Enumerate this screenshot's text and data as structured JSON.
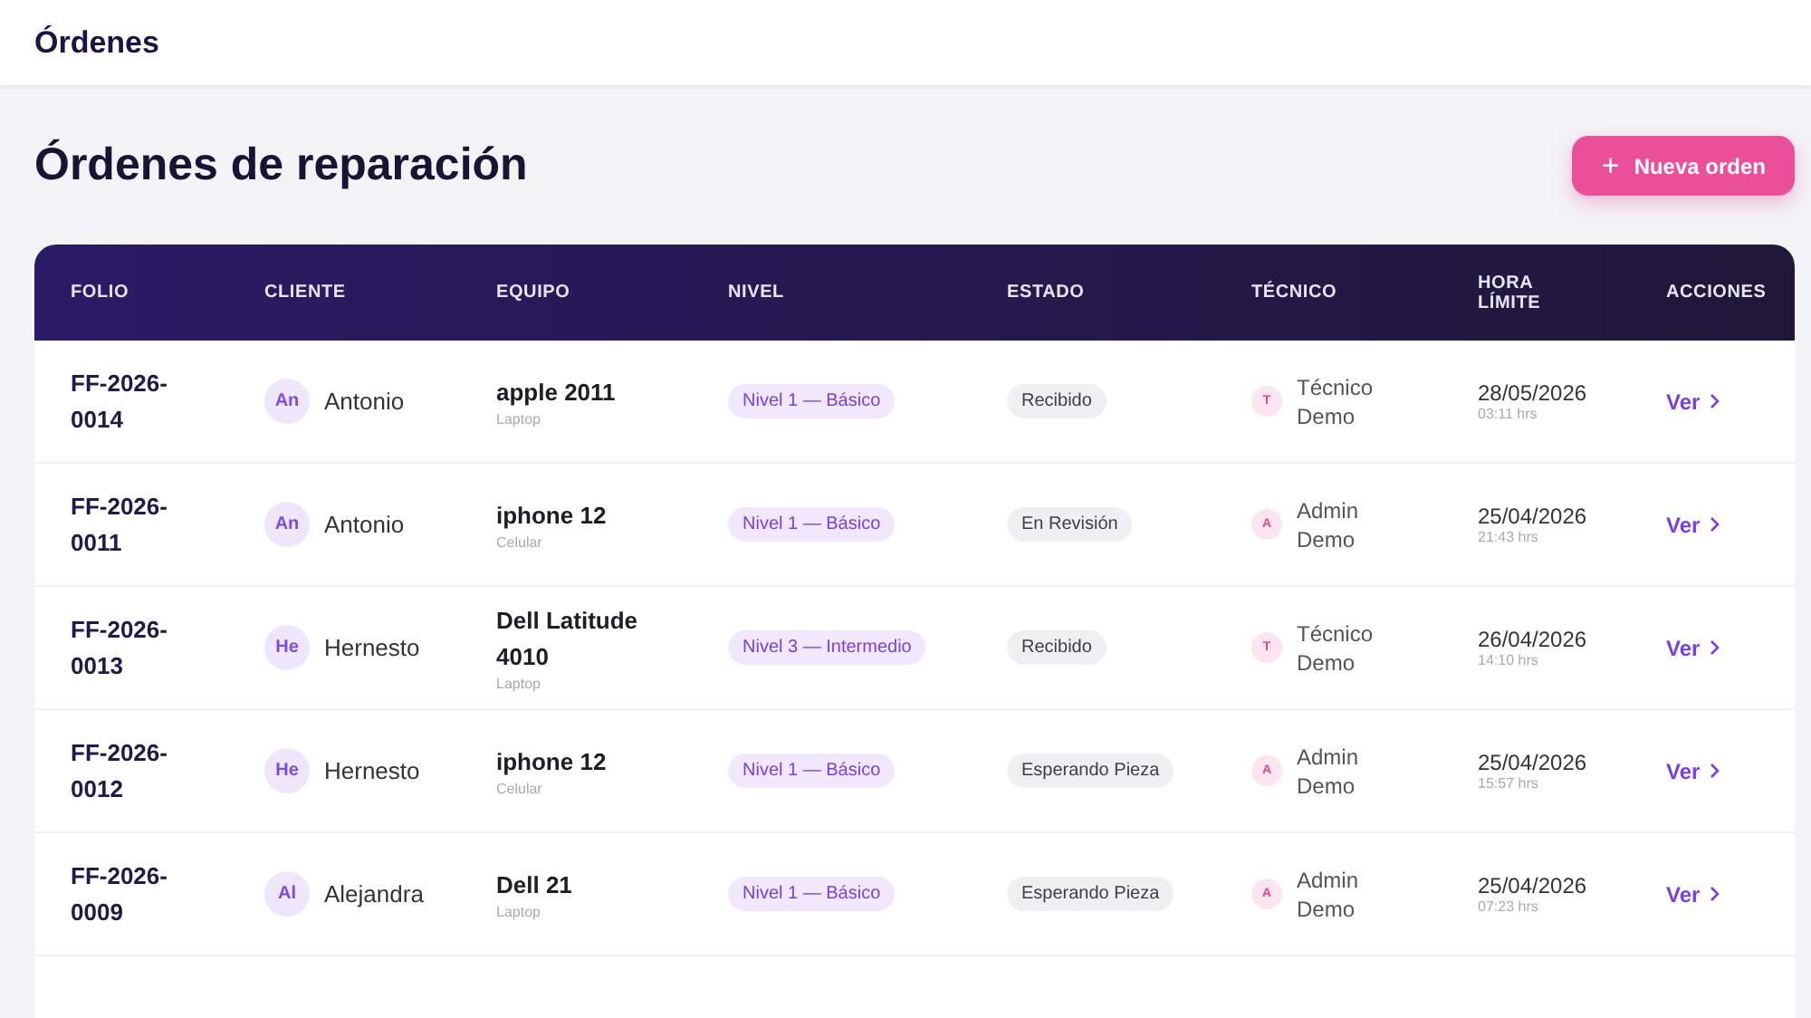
{
  "topbar": {
    "title": "Órdenes"
  },
  "page": {
    "title": "Órdenes de reparación",
    "new_button": {
      "icon": "+",
      "label": "Nueva orden"
    }
  },
  "table": {
    "columns": [
      "FOLIO",
      "CLIENTE",
      "EQUIPO",
      "NIVEL",
      "ESTADO",
      "TÉCNICO",
      "HORA LÍMITE",
      "ACCIONES"
    ],
    "rows": [
      {
        "folio": "FF-2026-0014",
        "client_initials": "An",
        "client": "Antonio",
        "device": "apple 2011",
        "device_type": "Laptop",
        "level": "Nivel 1 — Básico",
        "status": "Recibido",
        "tech_initial": "T",
        "tech": "Técnico Demo",
        "date": "28/05/2026",
        "time": "03:11 hrs",
        "action": "Ver"
      },
      {
        "folio": "FF-2026-0011",
        "client_initials": "An",
        "client": "Antonio",
        "device": "iphone 12",
        "device_type": "Celular",
        "level": "Nivel 1 — Básico",
        "status": "En Revisión",
        "tech_initial": "A",
        "tech": "Admin Demo",
        "date": "25/04/2026",
        "time": "21:43 hrs",
        "action": "Ver"
      },
      {
        "folio": "FF-2026-0013",
        "client_initials": "He",
        "client": "Hernesto",
        "device": "Dell Latitude 4010",
        "device_type": "Laptop",
        "level": "Nivel 3 — Intermedio",
        "status": "Recibido",
        "tech_initial": "T",
        "tech": "Técnico Demo",
        "date": "26/04/2026",
        "time": "14:10 hrs",
        "action": "Ver"
      },
      {
        "folio": "FF-2026-0012",
        "client_initials": "He",
        "client": "Hernesto",
        "device": "iphone 12",
        "device_type": "Celular",
        "level": "Nivel 1 — Básico",
        "status": "Esperando Pieza",
        "tech_initial": "A",
        "tech": "Admin Demo",
        "date": "25/04/2026",
        "time": "15:57 hrs",
        "action": "Ver"
      },
      {
        "folio": "FF-2026-0009",
        "client_initials": "Al",
        "client": "Alejandra",
        "device": "Dell 21",
        "device_type": "Laptop",
        "level": "Nivel 1 — Básico",
        "status": "Esperando Pieza",
        "tech_initial": "A",
        "tech": "Admin Demo",
        "date": "25/04/2026",
        "time": "07:23 hrs",
        "action": "Ver"
      }
    ]
  }
}
